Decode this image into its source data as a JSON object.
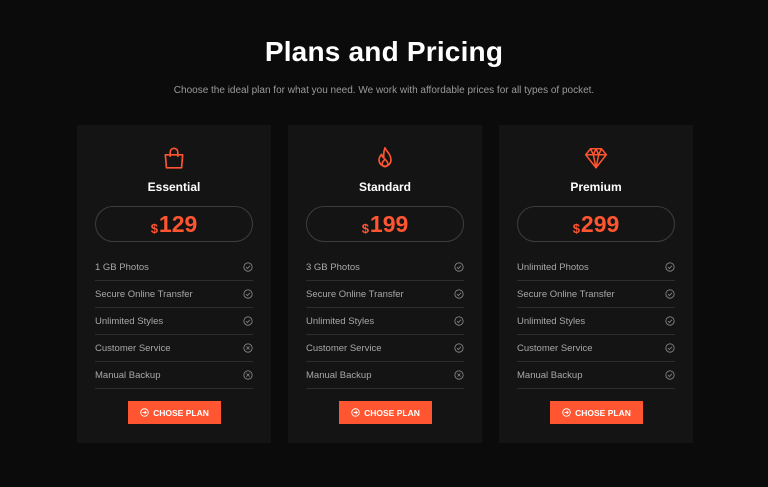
{
  "header": {
    "title": "Plans and Pricing",
    "subtitle": "Choose the ideal plan for what you need. We work with affordable prices for all types of pocket."
  },
  "colors": {
    "accent": "#ff5530",
    "background": "#0b0b0b",
    "card": "#141414"
  },
  "plans": [
    {
      "name": "Essential",
      "icon": "shopping-bag-icon",
      "currency": "$",
      "price": "129",
      "features": [
        {
          "label": "1 GB Photos",
          "included": true
        },
        {
          "label": "Secure Online Transfer",
          "included": true
        },
        {
          "label": "Unlimited Styles",
          "included": true
        },
        {
          "label": "Customer Service",
          "included": false
        },
        {
          "label": "Manual Backup",
          "included": false
        }
      ],
      "button_label": "CHOSE PLAN"
    },
    {
      "name": "Standard",
      "icon": "flame-icon",
      "currency": "$",
      "price": "199",
      "features": [
        {
          "label": "3 GB Photos",
          "included": true
        },
        {
          "label": "Secure Online Transfer",
          "included": true
        },
        {
          "label": "Unlimited Styles",
          "included": true
        },
        {
          "label": "Customer Service",
          "included": true
        },
        {
          "label": "Manual Backup",
          "included": false
        }
      ],
      "button_label": "CHOSE PLAN"
    },
    {
      "name": "Premium",
      "icon": "diamond-icon",
      "currency": "$",
      "price": "299",
      "features": [
        {
          "label": "Unlimited Photos",
          "included": true
        },
        {
          "label": "Secure Online Transfer",
          "included": true
        },
        {
          "label": "Unlimited Styles",
          "included": true
        },
        {
          "label": "Customer Service",
          "included": true
        },
        {
          "label": "Manual Backup",
          "included": true
        }
      ],
      "button_label": "CHOSE PLAN"
    }
  ]
}
